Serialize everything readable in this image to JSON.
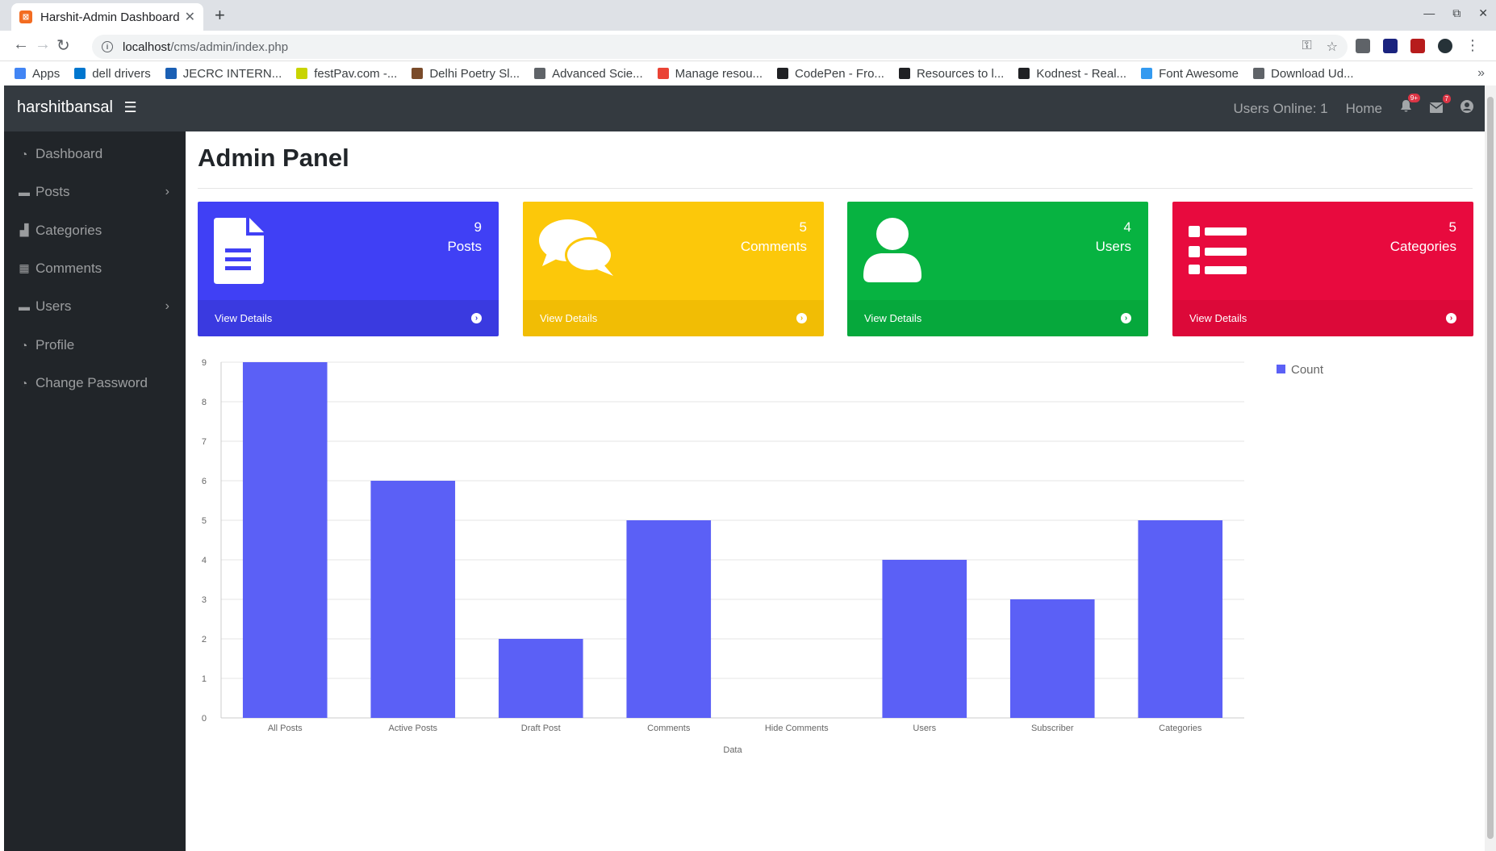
{
  "browser": {
    "tab_title": "Harshit-Admin Dashboard",
    "new_tab": "+",
    "url_host": "localhost",
    "url_path": "/cms/admin/index.php",
    "bookmarks": [
      {
        "label": "Apps",
        "color": "#4285f4"
      },
      {
        "label": "dell drivers",
        "color": "#0076ce"
      },
      {
        "label": "JECRC INTERN...",
        "color": "#1a5fb4"
      },
      {
        "label": "festPav.com -...",
        "color": "#c8d400"
      },
      {
        "label": "Delhi Poetry Sl...",
        "color": "#7a4b2a"
      },
      {
        "label": "Advanced Scie...",
        "color": "#5f6368"
      },
      {
        "label": "Manage resou...",
        "color": "#ea4335"
      },
      {
        "label": "CodePen - Fro...",
        "color": "#202124"
      },
      {
        "label": "Resources to l...",
        "color": "#202124"
      },
      {
        "label": "Kodnest - Real...",
        "color": "#202124"
      },
      {
        "label": "Font Awesome",
        "color": "#339af0"
      },
      {
        "label": "Download Ud...",
        "color": "#5f6368"
      }
    ],
    "bookmarks_more": "»"
  },
  "navbar": {
    "brand": "harshitbansal",
    "users_online": "Users Online: 1",
    "home": "Home",
    "notif_badge": "9+",
    "mail_badge": "7"
  },
  "sidebar": {
    "items": [
      {
        "label": "Dashboard",
        "icon": "dashboard-icon"
      },
      {
        "label": "Posts",
        "icon": "folder-icon",
        "chevron": true
      },
      {
        "label": "Categories",
        "icon": "chart-icon"
      },
      {
        "label": "Comments",
        "icon": "table-icon"
      },
      {
        "label": "Users",
        "icon": "folder-icon",
        "chevron": true
      },
      {
        "label": "Profile",
        "icon": "dashboard-icon"
      },
      {
        "label": "Change Password",
        "icon": "dashboard-icon"
      }
    ]
  },
  "main": {
    "title": "Admin Panel",
    "cards": [
      {
        "count": "9",
        "label": "Posts",
        "footer": "View Details",
        "color": "#4040f5"
      },
      {
        "count": "5",
        "label": "Comments",
        "footer": "View Details",
        "color": "#fcc80a"
      },
      {
        "count": "4",
        "label": "Users",
        "footer": "View Details",
        "color": "#07b341"
      },
      {
        "count": "5",
        "label": "Categories",
        "footer": "View Details",
        "color": "#e80a3e"
      }
    ]
  },
  "chart_data": {
    "type": "bar",
    "categories": [
      "All Posts",
      "Active Posts",
      "Draft Post",
      "Comments",
      "Hide Comments",
      "Users",
      "Subscriber",
      "Categories"
    ],
    "series": [
      {
        "name": "Count",
        "values": [
          9,
          6,
          2,
          5,
          0,
          4,
          3,
          5
        ],
        "color": "#5b60f6"
      }
    ],
    "xlabel": "Data",
    "ylabel": "",
    "ylim": [
      0,
      9
    ],
    "yticks": [
      0,
      1,
      2,
      3,
      4,
      5,
      6,
      7,
      8,
      9
    ],
    "grid": true,
    "legend": "right"
  }
}
